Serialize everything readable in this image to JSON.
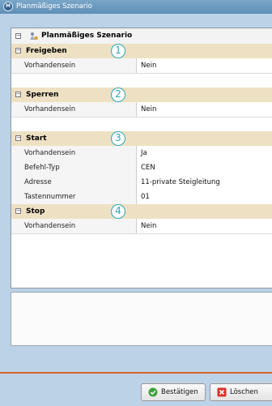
{
  "window": {
    "title": "Planmäßiges Szenario",
    "app_icon_text": "M"
  },
  "tree": {
    "root_label": "Planmäßiges Szenario",
    "expander_symbol": "⊟",
    "sections": [
      {
        "label": "Freigeben",
        "badge": "1",
        "props": [
          {
            "key": "Vorhandensein",
            "value": "Nein"
          }
        ]
      },
      {
        "label": "Sperren",
        "badge": "2",
        "props": [
          {
            "key": "Vorhandensein",
            "value": "Nein"
          }
        ]
      },
      {
        "label": "Start",
        "badge": "3",
        "props": [
          {
            "key": "Vorhandensein",
            "value": "Ja"
          },
          {
            "key": "Befehl-Typ",
            "value": "CEN"
          },
          {
            "key": "Adresse",
            "value": "11-private Steigleitung"
          },
          {
            "key": "Tastennummer",
            "value": "01"
          }
        ]
      },
      {
        "label": "Stop",
        "badge": "4",
        "props": [
          {
            "key": "Vorhandensein",
            "value": "Nein"
          }
        ]
      }
    ]
  },
  "buttons": {
    "confirm_label": "Bestätigen",
    "delete_label": "Löschen"
  },
  "colors": {
    "section_bg": "#eee1c3",
    "badge": "#2fa6b6",
    "footer_accent": "#d9652a",
    "window_bg": "#bcd2e6"
  }
}
